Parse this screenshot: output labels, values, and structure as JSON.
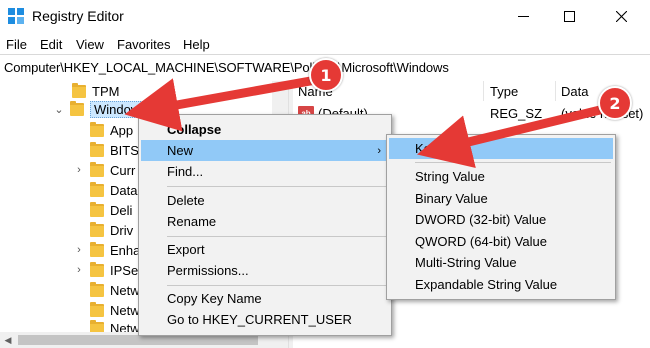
{
  "window": {
    "title": "Registry Editor",
    "minimize_glyph": "—",
    "maximize_glyph": "☐",
    "close_glyph": "✕"
  },
  "menubar": [
    "File",
    "Edit",
    "View",
    "Favorites",
    "Help"
  ],
  "address": "Computer\\HKEY_LOCAL_MACHINE\\SOFTWARE\\Policies\\Microsoft\\Windows",
  "tree": {
    "tpm": "TPM",
    "windows": "Windows",
    "children": [
      "App",
      "BITS",
      "Curr",
      "Data",
      "Deli",
      "Driv",
      "Enha",
      "IPSe",
      "Netw",
      "Netw",
      "Netw"
    ]
  },
  "list": {
    "headers": {
      "name": "Name",
      "type": "Type",
      "data": "Data"
    },
    "rows": [
      {
        "name": "(Default)",
        "type": "REG_SZ",
        "data": "(value not set)"
      }
    ]
  },
  "context_menu": {
    "collapse": "Collapse",
    "new": "New",
    "find": "Find...",
    "delete": "Delete",
    "rename": "Rename",
    "export": "Export",
    "permissions": "Permissions...",
    "copy_key_name": "Copy Key Name",
    "goto": "Go to HKEY_CURRENT_USER",
    "submenu_arrow": "›"
  },
  "new_submenu": {
    "items": [
      "Key",
      "String Value",
      "Binary Value",
      "DWORD (32-bit) Value",
      "QWORD (64-bit) Value",
      "Multi-String Value",
      "Expandable String Value"
    ]
  },
  "callouts": {
    "one": "1",
    "two": "2"
  },
  "colors": {
    "highlight": "#91c9f7",
    "callout": "#e53935",
    "folder": "#f5c441"
  }
}
